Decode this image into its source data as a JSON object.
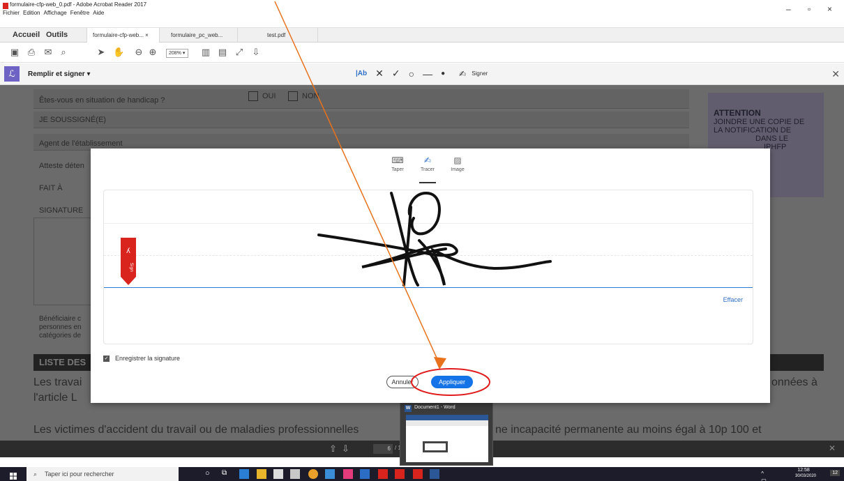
{
  "window": {
    "title": "formulaire-cfp-web_0.pdf - Adobe Acrobat Reader 2017",
    "menu": [
      "Fichier",
      "Edition",
      "Affichage",
      "Fenêtre",
      "Aide"
    ],
    "controls": [
      "–",
      "▫",
      "×"
    ]
  },
  "tabs": {
    "home": "Accueil",
    "tools": "Outils",
    "docs": [
      {
        "label": "formulaire-cfp-web... ×"
      },
      {
        "label": "formulaire_pc_web..."
      },
      {
        "label": "test.pdf"
      }
    ]
  },
  "toolbar": {
    "zoom": "208%"
  },
  "signbar": {
    "title": "Remplir et signer",
    "signer_label": "Signer"
  },
  "document": {
    "handicap": "Êtes-vous en situation de handicap ?",
    "oui": "OUI",
    "non": "NON",
    "soussigne": "JE SOUSSIGNÉ(E)",
    "agent": "Agent de l'établissement",
    "atteste": "Atteste déten",
    "fait": "FAIT À",
    "signature": "SIGNATURE",
    "beneficiaire": "Bénéficiaire c",
    "personnes": "personnes en",
    "categories": "catégories de",
    "attention_title": "ATTENTION",
    "attention_lines": [
      "JOINDRE UNE COPIE DE",
      "LA NOTIFICATION DE",
      "DANS LE",
      "IPHFP"
    ],
    "liste": "LISTE DES",
    "text1": "Les travai",
    "text1_end": "onnées à",
    "text2": "l'article L",
    "text3": "Les victimes d'accident du travail ou de maladies professionnelles",
    "text3_end": "ne incapacité permanente au moins égal à 10p 100 et"
  },
  "pagebar": {
    "current": "6",
    "total": "/ 13"
  },
  "modal": {
    "modes": [
      {
        "label": "Taper",
        "icon": "keyboard-icon"
      },
      {
        "label": "Tracer",
        "icon": "pen-icon"
      },
      {
        "label": "Image",
        "icon": "image-icon"
      }
    ],
    "clear": "Effacer",
    "save_signature": "Enregistrer la signature",
    "cancel": "Annuler",
    "apply": "Appliquer"
  },
  "thumbnail": {
    "title": "Document1 - Word"
  },
  "taskbar": {
    "search_placeholder": "Taper ici pour rechercher",
    "time": "12:58",
    "date": "30/03/2020",
    "notif": "12"
  },
  "colors": {
    "accent": "#1473e6",
    "annotation": "#e8721c",
    "circle": "#e11b1b",
    "sign_badge": "#6e63c4"
  }
}
